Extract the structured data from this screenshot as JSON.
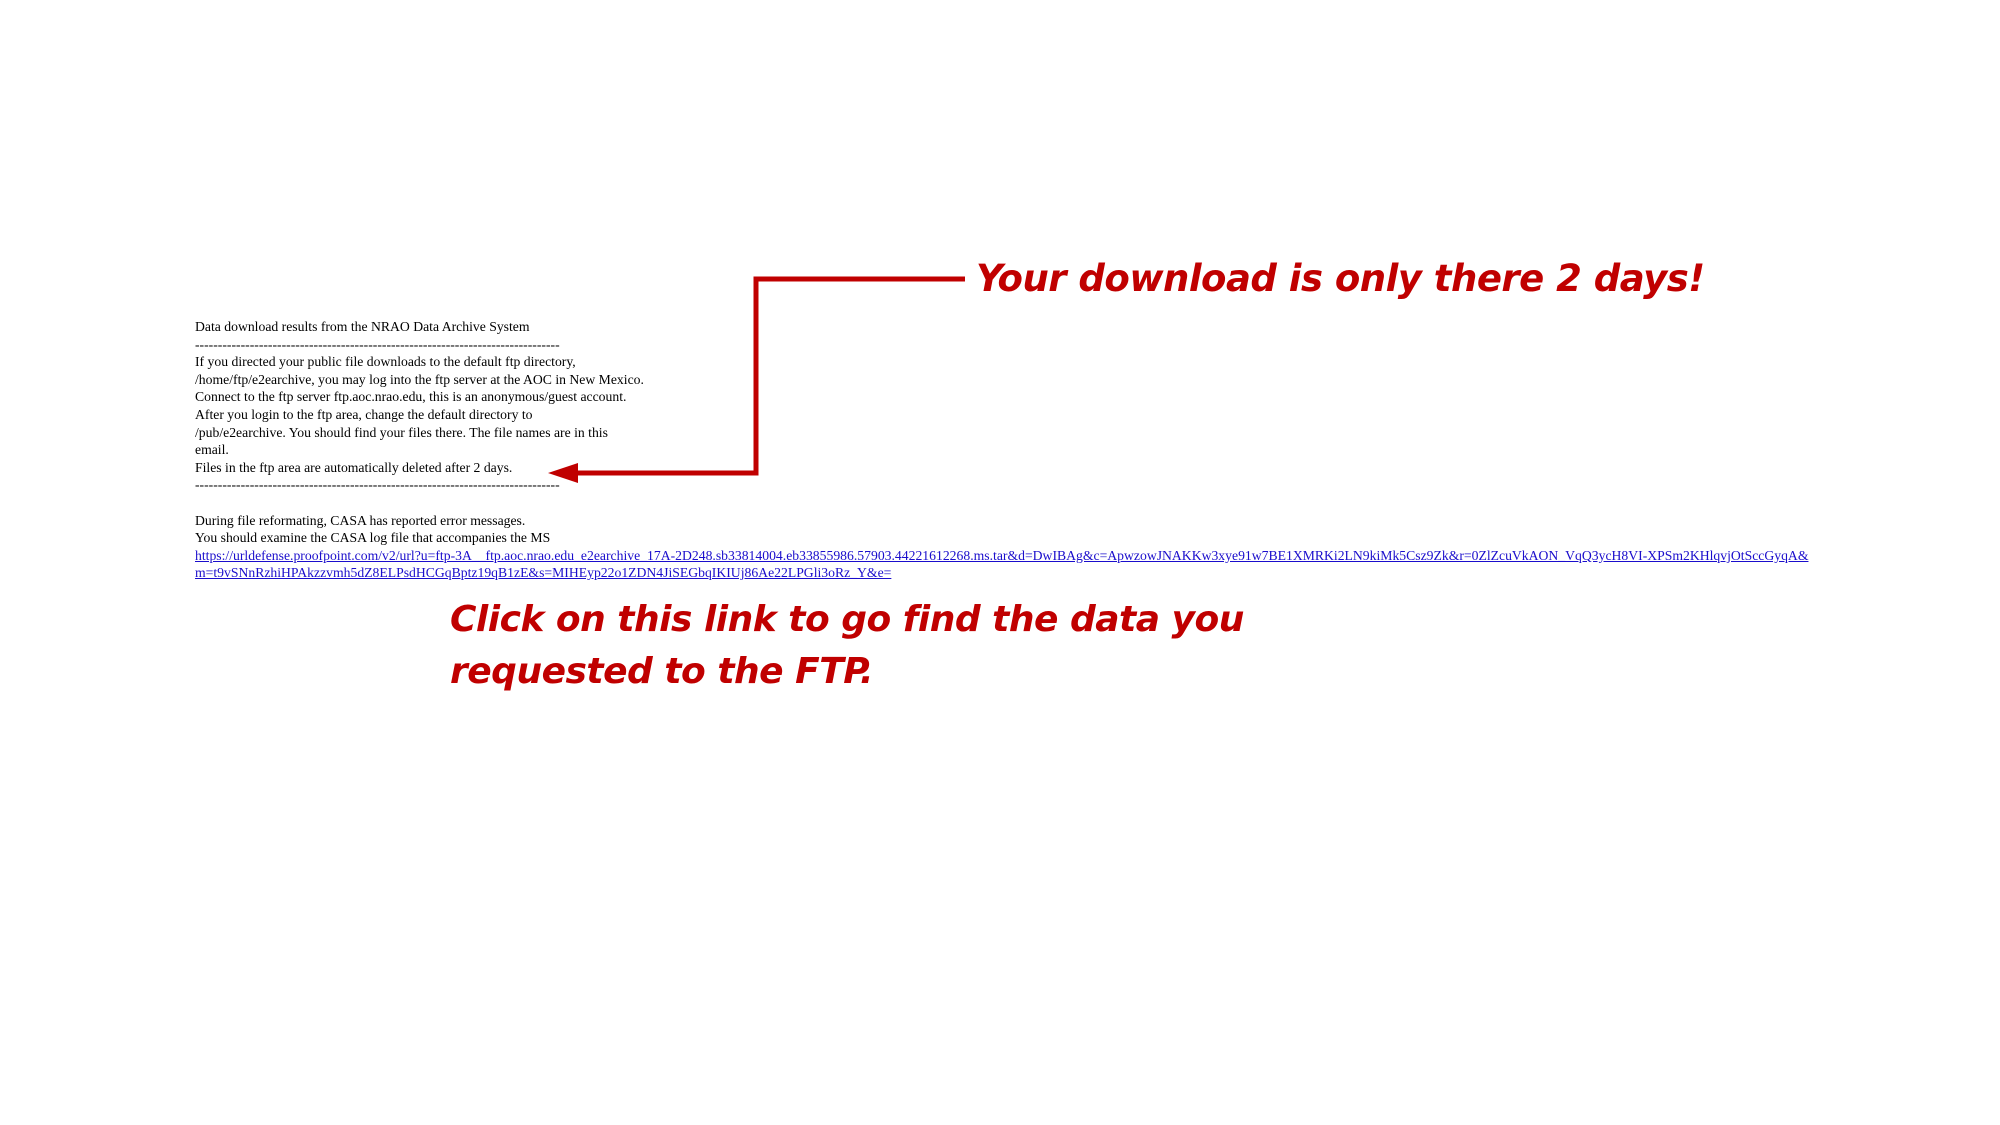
{
  "email": {
    "title": "Data download results from the NRAO Data Archive System",
    "separator": "--------------------------------------------------------------------------------",
    "paragraph1": [
      "If you directed your public file downloads to the default ftp directory,",
      "/home/ftp/e2earchive, you may log into the ftp server at the AOC in New Mexico.",
      "Connect to the ftp server ftp.aoc.nrao.edu, this is an anonymous/guest account.",
      "After you login to the ftp area, change the default directory to",
      "/pub/e2earchive. You should find your files there. The file names are in this",
      "email.",
      "Files in the ftp area are automatically deleted after 2 days."
    ],
    "paragraph2": [
      "During file reformating, CASA has reported error messages.",
      "You should examine the CASA log file that accompanies the MS"
    ],
    "link_text": "https://urldefense.proofpoint.com/v2/url?u=ftp-3A__ftp.aoc.nrao.edu_e2earchive_17A-2D248.sb33814004.eb33855986.57903.44221612268.ms.tar&d=DwIBAg&c=ApwzowJNAKKw3xye91w7BE1XMRKi2LN9kiMk5Csz9Zk&r=0ZlZcuVkAON_VqQ3ycH8VI-XPSm2KHlqvjOtSccGyqA&m=t9vSNnRzhiHPAkzzvmh5dZ8ELPsdHCGqBptz19qB1zE&s=MIHEyp22o1ZDN4JiSEGbqIKIUj86Ae22LPGli3oRz_Y&e="
  },
  "annotations": {
    "top": "Your download is only there 2 days!",
    "bottom_line1": "Click on this link to go find the data you",
    "bottom_line2": "requested to the FTP."
  },
  "colors": {
    "annotation": "#c00000",
    "link": "#1a0dcc",
    "text": "#000000"
  }
}
